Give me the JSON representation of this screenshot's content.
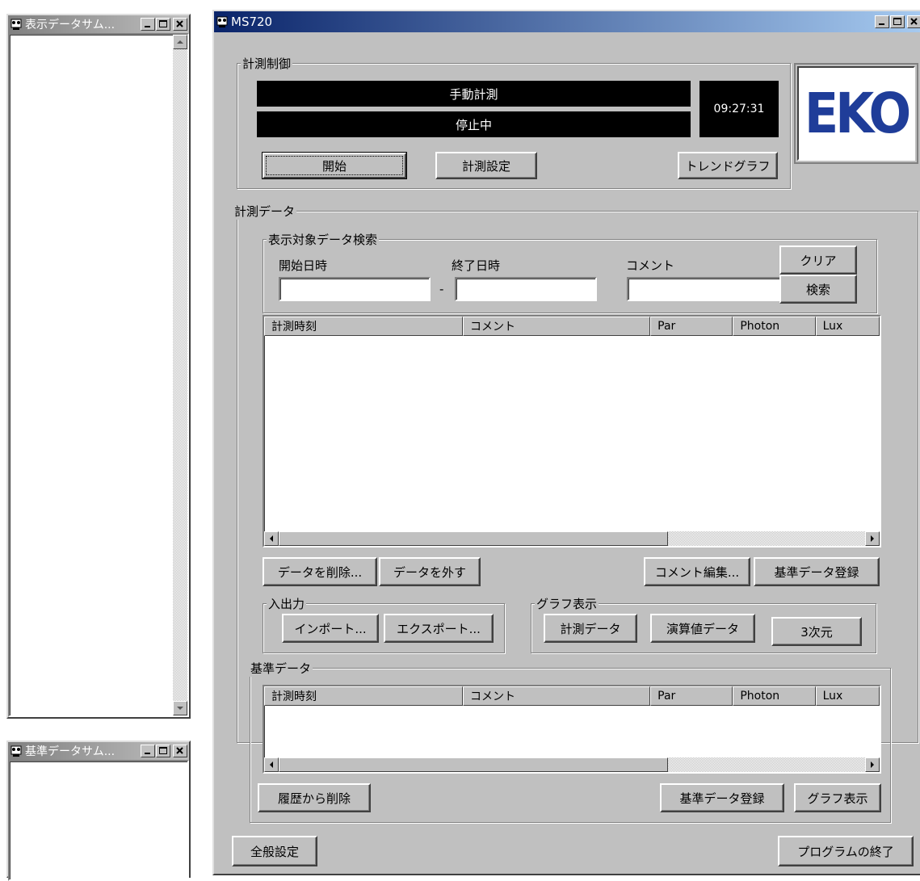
{
  "left_window_top": {
    "title": "表示データサム..."
  },
  "left_window_bottom": {
    "title": "基準データサム..."
  },
  "main_window": {
    "title": "MS720"
  },
  "measure_control": {
    "group_label": "計測制御",
    "mode_text": "手動計測",
    "status_text": "停止中",
    "time_text": "09:27:31",
    "start_button": "開始",
    "settings_button": "計測設定",
    "trend_button": "トレンドグラフ",
    "logo_text": "EKO"
  },
  "measure_data": {
    "group_label": "計測データ",
    "search": {
      "group_label": "表示対象データ検索",
      "start_label": "開始日時",
      "end_label": "終了日時",
      "comment_label": "コメント",
      "dash": "-",
      "start_value": "",
      "end_value": "",
      "comment_value": "",
      "clear_button": "クリア",
      "search_button": "検索"
    },
    "columns": [
      "計測時刻",
      "コメント",
      "Par",
      "Photon",
      "Lux"
    ],
    "rows": [],
    "delete_button": "データを削除...",
    "remove_button": "データを外す",
    "edit_comment_button": "コメント編集...",
    "register_ref_button": "基準データ登録",
    "io": {
      "group_label": "入出力",
      "import_button": "インポート...",
      "export_button": "エクスポート..."
    },
    "graph": {
      "group_label": "グラフ表示",
      "measure_button": "計測データ",
      "calc_button": "演算値データ",
      "three_d_button": "3次元"
    }
  },
  "ref_data": {
    "group_label": "基準データ",
    "columns": [
      "計測時刻",
      "コメント",
      "Par",
      "Photon",
      "Lux"
    ],
    "rows": [],
    "delete_history_button": "履歴から削除",
    "register_button": "基準データ登録",
    "graph_button": "グラフ表示"
  },
  "footer": {
    "general_settings_button": "全般設定",
    "exit_button": "プログラムの終了"
  },
  "colors": {
    "face": "#c0c0c0",
    "title_active": "#0a246a",
    "logo_blue": "#1f3d99"
  }
}
